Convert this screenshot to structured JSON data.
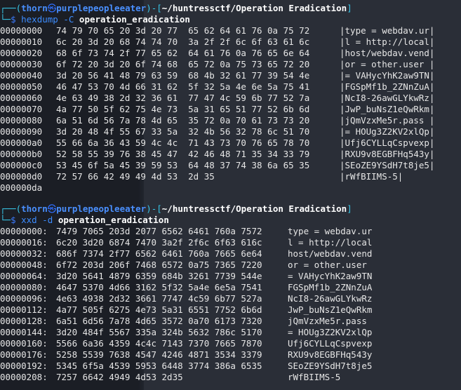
{
  "prompt1": {
    "bracket_open": "┌──(",
    "user": "thorn",
    "at_icon": "㉿",
    "host": "purplepeopleeater",
    "sep": ")-[",
    "path": "~/huntressctf/Operation Eradication",
    "bracket_close": "]",
    "lower": "└─",
    "dollar": "$ ",
    "cmd": "hexdump",
    "flag": " -C ",
    "arg": "operation_eradication"
  },
  "hexdump_rows": [
    {
      "off": "00000000",
      "hex": "74 79 70 65 20 3d 20 77  65 62 64 61 76 0a 75 72",
      "asc": "|type = webdav.ur|"
    },
    {
      "off": "00000010",
      "hex": "6c 20 3d 20 68 74 74 70  3a 2f 2f 6c 6f 63 61 6c",
      "asc": "|l = http://local|"
    },
    {
      "off": "00000020",
      "hex": "68 6f 73 74 2f 77 65 62  64 61 76 0a 76 65 6e 64",
      "asc": "|host/webdav.vend|"
    },
    {
      "off": "00000030",
      "hex": "6f 72 20 3d 20 6f 74 68  65 72 0a 75 73 65 72 20",
      "asc": "|or = other.user |"
    },
    {
      "off": "00000040",
      "hex": "3d 20 56 41 48 79 63 59  68 4b 32 61 77 39 54 4e",
      "asc": "|= VAHycYhK2aw9TN|"
    },
    {
      "off": "00000050",
      "hex": "46 47 53 70 4d 66 31 62  5f 32 5a 4e 6e 5a 75 41",
      "asc": "|FGSpMf1b_2ZNnZuA|"
    },
    {
      "off": "00000060",
      "hex": "4e 63 49 38 2d 32 36 61  77 47 4c 59 6b 77 52 7a",
      "asc": "|NcI8-26awGLYkwRz|"
    },
    {
      "off": "00000070",
      "hex": "4a 77 50 5f 62 75 4e 73  5a 31 65 51 77 52 6b 6d",
      "asc": "|JwP_buNsZ1eQwRkm|"
    },
    {
      "off": "00000080",
      "hex": "6a 51 6d 56 7a 78 4d 65  35 72 0a 70 61 73 73 20",
      "asc": "|jQmVzxMe5r.pass |"
    },
    {
      "off": "00000090",
      "hex": "3d 20 48 4f 55 67 33 5a  32 4b 56 32 78 6c 51 70",
      "asc": "|= HOUg3Z2KV2xlQp|"
    },
    {
      "off": "000000a0",
      "hex": "55 66 6a 36 43 59 4c 4c  71 43 73 70 76 65 78 70",
      "asc": "|Ufj6CYLLqCspvexp|"
    },
    {
      "off": "000000b0",
      "hex": "52 58 55 39 76 38 45 47  42 46 48 71 35 34 33 79",
      "asc": "|RXU9v8EGBFHq543y|"
    },
    {
      "off": "000000c0",
      "hex": "53 45 6f 5a 45 39 59 53  64 48 37 74 38 6a 65 35",
      "asc": "|SEoZE9YSdH7t8je5|"
    },
    {
      "off": "000000d0",
      "hex": "72 57 66 42 49 49 4d 53  2d 35",
      "asc": "|rWfBIIMS-5|"
    },
    {
      "off": "000000da",
      "hex": "",
      "asc": ""
    }
  ],
  "prompt2": {
    "bracket_open": "┌──(",
    "user": "thorn",
    "at_icon": "㉿",
    "host": "purplepeopleeater",
    "sep": ")-[",
    "path": "~/huntressctf/Operation Eradication",
    "bracket_close": "]",
    "lower": "└─",
    "dollar": "$ ",
    "cmd": "xxd",
    "flag": " -d ",
    "arg": "operation_eradication"
  },
  "xxd_rows": [
    {
      "off": "00000000:",
      "hex": "7479 7065 203d 2077 6562 6461 760a 7572",
      "asc": "type = webdav.ur"
    },
    {
      "off": "00000016:",
      "hex": "6c20 3d20 6874 7470 3a2f 2f6c 6f63 616c",
      "asc": "l = http://local"
    },
    {
      "off": "00000032:",
      "hex": "686f 7374 2f77 6562 6461 760a 7665 6e64",
      "asc": "host/webdav.vend"
    },
    {
      "off": "00000048:",
      "hex": "6f72 203d 206f 7468 6572 0a75 7365 7220",
      "asc": "or = other.user "
    },
    {
      "off": "00000064:",
      "hex": "3d20 5641 4879 6359 684b 3261 7739 544e",
      "asc": "= VAHycYhK2aw9TN"
    },
    {
      "off": "00000080:",
      "hex": "4647 5370 4d66 3162 5f32 5a4e 6e5a 7541",
      "asc": "FGSpMf1b_2ZNnZuA"
    },
    {
      "off": "00000096:",
      "hex": "4e63 4938 2d32 3661 7747 4c59 6b77 527a",
      "asc": "NcI8-26awGLYkwRz"
    },
    {
      "off": "00000112:",
      "hex": "4a77 505f 6275 4e73 5a31 6551 7752 6b6d",
      "asc": "JwP_buNsZ1eQwRkm"
    },
    {
      "off": "00000128:",
      "hex": "6a51 6d56 7a78 4d65 3572 0a70 6173 7320",
      "asc": "jQmVzxMe5r.pass "
    },
    {
      "off": "00000144:",
      "hex": "3d20 484f 5567 335a 324b 5632 786c 5170",
      "asc": "= HOUg3Z2KV2xlQp"
    },
    {
      "off": "00000160:",
      "hex": "5566 6a36 4359 4c4c 7143 7370 7665 7870",
      "asc": "Ufj6CYLLqCspvexp"
    },
    {
      "off": "00000176:",
      "hex": "5258 5539 7638 4547 4246 4871 3534 3379",
      "asc": "RXU9v8EGBFHq543y"
    },
    {
      "off": "00000192:",
      "hex": "5345 6f5a 4539 5953 6448 3774 386a 6535",
      "asc": "SEoZE9YSdH7t8je5"
    },
    {
      "off": "00000208:",
      "hex": "7257 6642 4949 4d53 2d35",
      "asc": "rWfBIIMS-5"
    }
  ]
}
